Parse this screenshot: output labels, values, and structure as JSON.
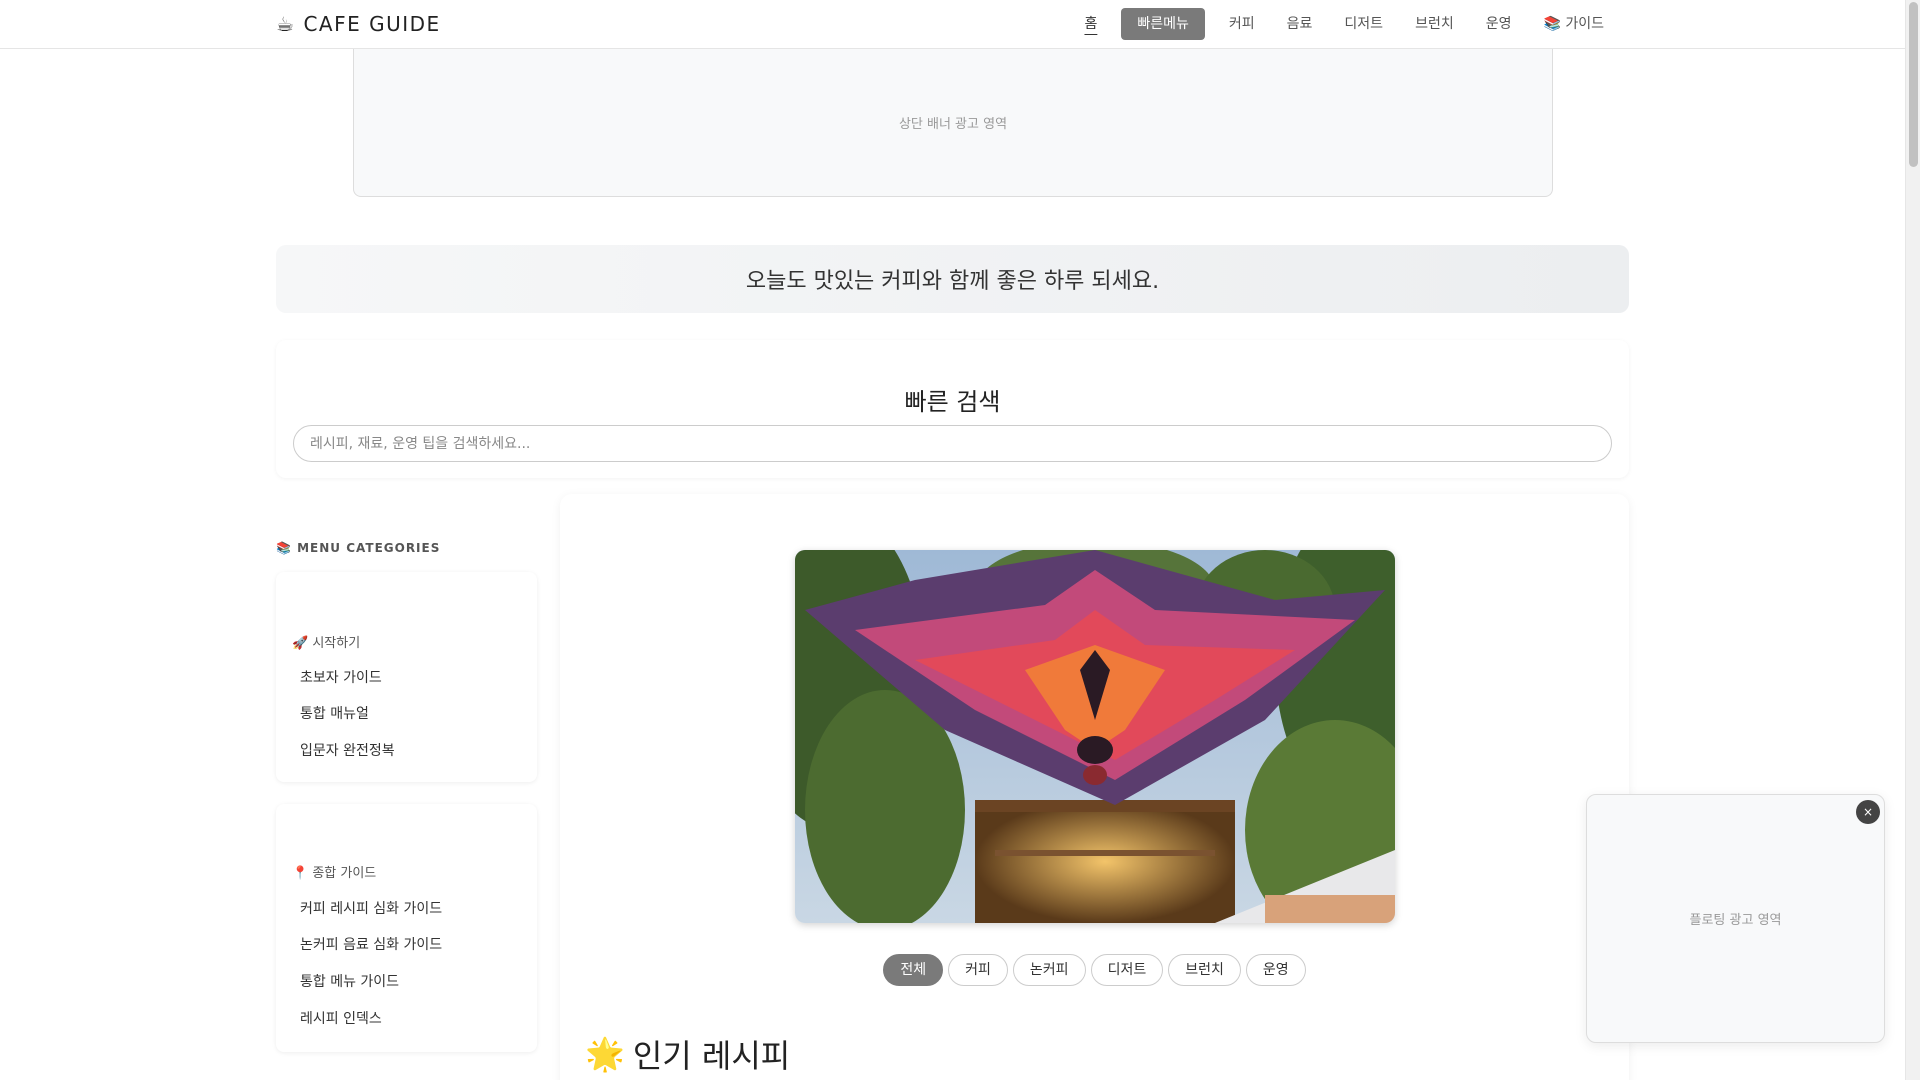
{
  "header": {
    "logo_icon": "☕",
    "logo_text": "CAFE GUIDE",
    "nav": [
      {
        "label": "홈"
      },
      {
        "label": "빠른메뉴"
      },
      {
        "label": "커피"
      },
      {
        "label": "음료"
      },
      {
        "label": "디저트"
      },
      {
        "label": "브런치"
      },
      {
        "label": "운영"
      },
      {
        "label": "📚 가이드"
      }
    ]
  },
  "top_ad": {
    "label": "상단 배너 광고 영역"
  },
  "greeting": {
    "text": "오늘도 맛있는 커피와 함께 좋은 하루 되세요."
  },
  "search": {
    "title": "빠른 검색",
    "placeholder": "레시피, 재료, 운영 팁을 검색하세요..."
  },
  "sidebar": {
    "title": "📚 MENU CATEGORIES",
    "groups": [
      {
        "heading": "🚀 시작하기",
        "links": [
          "초보자 가이드",
          "통합 매뉴얼",
          "입문자 완전정복"
        ]
      },
      {
        "heading": "📍 종합 가이드",
        "links": [
          "커피 레시피 심화 가이드",
          "논커피 음료 심화 가이드",
          "통합 메뉴 가이드",
          "레시피 인덱스"
        ]
      }
    ]
  },
  "main": {
    "filters": [
      "전체",
      "커피",
      "논커피",
      "디저트",
      "브런치",
      "운영"
    ],
    "active_filter": "전체",
    "section_icon": "🌟",
    "section_title": "인기 레시피"
  },
  "float_ad": {
    "label": "플로팅 광고 영역",
    "close_label": "×"
  },
  "colors": {
    "accent": "#7a7a7a"
  }
}
